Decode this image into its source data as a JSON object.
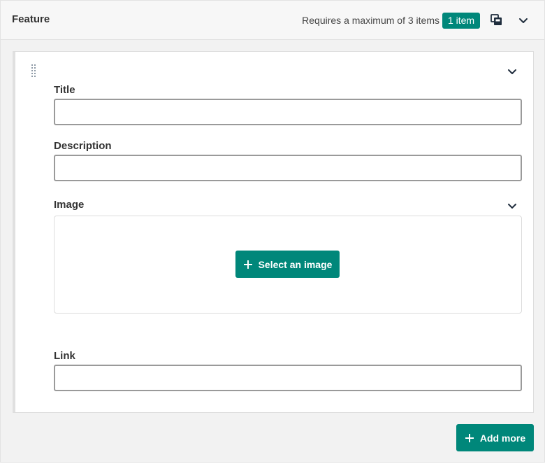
{
  "header": {
    "title": "Feature",
    "requirement": "Requires a maximum of 3 items",
    "count_badge": "1 item"
  },
  "item": {
    "fields": {
      "title": {
        "label": "Title",
        "value": "",
        "placeholder": ""
      },
      "description": {
        "label": "Description",
        "value": "",
        "placeholder": ""
      },
      "image": {
        "label": "Image",
        "select_button": "Select an image"
      },
      "link": {
        "label": "Link",
        "value": "",
        "placeholder": ""
      }
    }
  },
  "footer": {
    "add_more": "Add more"
  },
  "icons": {
    "copy": "copy-icon",
    "collapse": "chevron-down-icon",
    "drag": "drag-handle-icon",
    "plus": "plus-icon"
  },
  "colors": {
    "accent": "#00877a"
  }
}
